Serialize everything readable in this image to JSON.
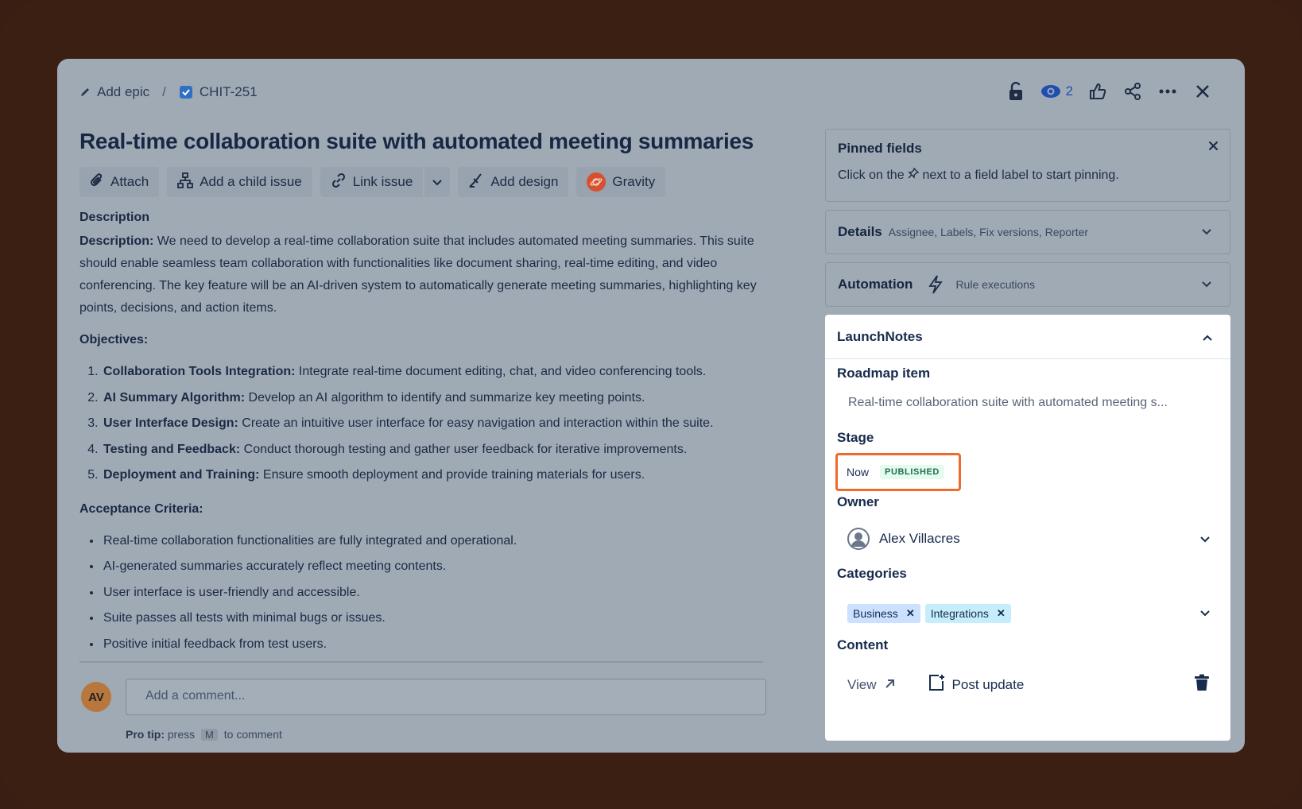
{
  "breadcrumb": {
    "epic_label": "Add epic",
    "separator": "/",
    "issue_key": "CHIT-251"
  },
  "header": {
    "watch_count": "2"
  },
  "issue": {
    "title": "Real-time collaboration suite with automated meeting summaries"
  },
  "toolbar": {
    "attach": "Attach",
    "add_child": "Add a child issue",
    "link_issue": "Link issue",
    "add_design": "Add design",
    "gravity": "Gravity"
  },
  "description": {
    "heading": "Description",
    "intro_label": "Description:",
    "intro_text": " We need to develop a real-time collaboration suite that includes automated meeting summaries. This suite should enable seamless team collaboration with functionalities like document sharing, real-time editing, and video conferencing. The key feature will be an AI-driven system to automatically generate meeting summaries, highlighting key points, decisions, and action items.",
    "objectives_label": "Objectives:",
    "objectives": [
      {
        "label": "Collaboration Tools Integration:",
        "text": " Integrate real-time document editing, chat, and video conferencing tools."
      },
      {
        "label": "AI Summary Algorithm:",
        "text": " Develop an AI algorithm to identify and summarize key meeting points."
      },
      {
        "label": "User Interface Design:",
        "text": " Create an intuitive user interface for easy navigation and interaction within the suite."
      },
      {
        "label": "Testing and Feedback:",
        "text": " Conduct thorough testing and gather user feedback for iterative improvements."
      },
      {
        "label": "Deployment and Training:",
        "text": " Ensure smooth deployment and provide training materials for users."
      }
    ],
    "criteria_label": "Acceptance Criteria:",
    "criteria": [
      "Real-time collaboration functionalities are fully integrated and operational.",
      "AI-generated summaries accurately reflect meeting contents.",
      "User interface is user-friendly and accessible.",
      "Suite passes all tests with minimal bugs or issues.",
      "Positive initial feedback from test users."
    ]
  },
  "comment": {
    "avatar_initials": "AV",
    "placeholder": "Add a comment...",
    "protip_label": "Pro tip:",
    "protip_press": "press",
    "protip_key": "M",
    "protip_suffix": "to comment"
  },
  "pinned": {
    "title": "Pinned fields",
    "hint_before": "Click on the",
    "hint_after": "next to a field label to start pinning."
  },
  "details": {
    "title": "Details",
    "subtitle": "Assignee, Labels, Fix versions, Reporter"
  },
  "automation": {
    "title": "Automation",
    "subtitle": "Rule executions"
  },
  "launchnotes": {
    "title": "LaunchNotes",
    "roadmap_label": "Roadmap item",
    "roadmap_value": "Real-time collaboration suite with automated meeting s...",
    "stage_label": "Stage",
    "stage_value": "Now",
    "stage_badge": "PUBLISHED",
    "owner_label": "Owner",
    "owner_value": "Alex Villacres",
    "categories_label": "Categories",
    "categories": [
      "Business",
      "Integrations"
    ],
    "content_label": "Content",
    "view_label": "View",
    "post_update_label": "Post update"
  },
  "colors": {
    "highlight": "#ef6a2c",
    "badge_bg": "#e3fcef",
    "badge_text": "#216e4e",
    "overlay": "#a0aab5"
  }
}
